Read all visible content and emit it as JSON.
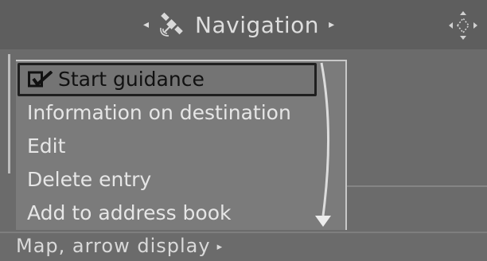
{
  "header": {
    "title": "Navigation",
    "left_arrow": "◂",
    "right_arrow": "▸",
    "icon": "satellite-icon",
    "controller_icon": "controller-direction-icon"
  },
  "menu": {
    "items": [
      {
        "label": "Start guidance",
        "selected": true,
        "icon": "checkmark-icon"
      },
      {
        "label": "Information on destination",
        "selected": false
      },
      {
        "label": "Edit",
        "selected": false
      },
      {
        "label": "Delete entry",
        "selected": false
      },
      {
        "label": "Add to address book",
        "selected": false
      }
    ],
    "scroll_down_arrow": "▾"
  },
  "footer": {
    "label": "Map, arrow display",
    "arrow": "▸"
  }
}
